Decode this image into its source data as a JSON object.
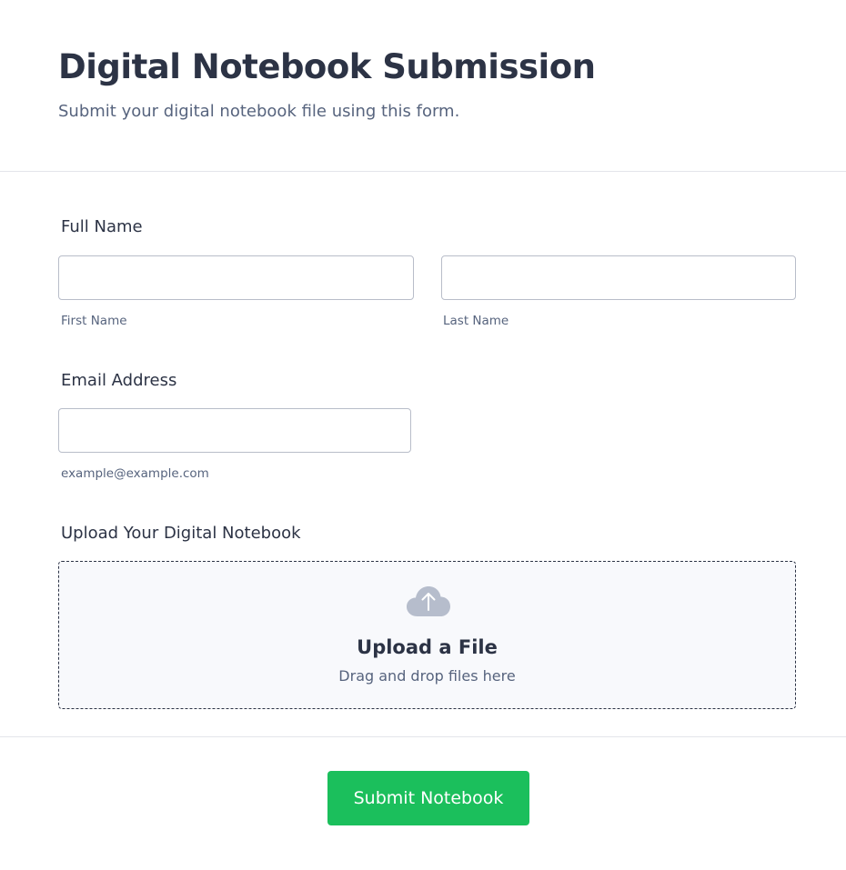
{
  "header": {
    "title": "Digital Notebook Submission",
    "subtitle": "Submit your digital notebook file using this form."
  },
  "form": {
    "full_name": {
      "label": "Full Name",
      "first_name": {
        "value": "",
        "sublabel": "First Name"
      },
      "last_name": {
        "value": "",
        "sublabel": "Last Name"
      }
    },
    "email": {
      "label": "Email Address",
      "value": "",
      "sublabel": "example@example.com"
    },
    "upload": {
      "label": "Upload Your Digital Notebook",
      "icon": "cloud-upload-icon",
      "title": "Upload a File",
      "hint": "Drag and drop files here"
    }
  },
  "footer": {
    "submit_label": "Submit Notebook"
  },
  "colors": {
    "text": "#2c3345",
    "muted": "#57647e",
    "border": "#b8bdc9",
    "upload_bg": "#f8f9fc",
    "icon": "#b6bdcc",
    "submit": "#1bbf5c"
  }
}
